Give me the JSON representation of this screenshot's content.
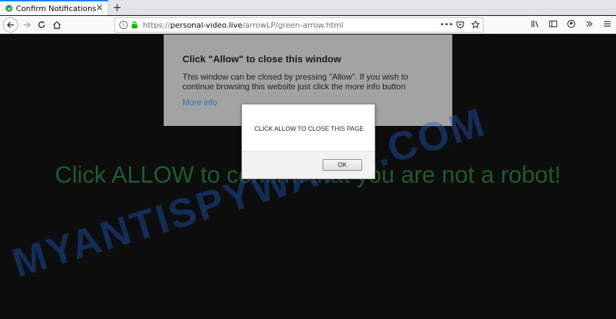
{
  "browser": {
    "tab_title": "Confirm Notifications",
    "tab_close": "×",
    "new_tab": "+",
    "url_scheme": "https://",
    "url_host": "personal-video.live",
    "url_path": "/arrowLP/green-arrow.html",
    "url_menu_icon": "•••",
    "toolbar_icons": [
      "library-icon",
      "sidebar-icon",
      "account-icon",
      "overflow-icon",
      "hamburger-menu-icon"
    ]
  },
  "notification_panel": {
    "title": "Click \"Allow\" to close this window",
    "body": "This window can be closed by pressing \"Allow\". If you wish to continue browsing this website just click the more info button",
    "more_info": "More info"
  },
  "page": {
    "headline": "Click ALLOW to confirm that you are not a robot!",
    "watermark": "MYANTISPYWARE.COM"
  },
  "dialog": {
    "message": "CLICK ALLOW TO CLOSE THIS PAGE",
    "ok_label": "OK"
  },
  "colors": {
    "headline": "#1e5a31",
    "watermark": "#1e5abe",
    "tab_accent": "#0a84ff",
    "lock_green": "#12bc00"
  }
}
